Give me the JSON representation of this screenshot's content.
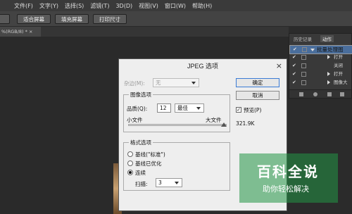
{
  "menubar": {
    "items": [
      "文件(F)",
      "文字(Y)",
      "选择(S)",
      "滤镜(T)",
      "3D(D)",
      "视图(V)",
      "窗口(W)",
      "帮助(H)"
    ]
  },
  "options_bar": {
    "buttons": [
      "适合屏幕",
      "填充屏幕",
      "打印尺寸"
    ]
  },
  "document_tab": {
    "label": "%(RGB/8) * ×"
  },
  "panel": {
    "tabs": [
      "历史记录",
      "动作"
    ],
    "rows": [
      "批量处理图",
      "打开",
      "关闭",
      "打开",
      "图像大"
    ]
  },
  "dialog": {
    "title": "JPEG 选项",
    "matte_label": "杂边(M):",
    "matte_value": "无",
    "image_options_title": "图像选项",
    "quality_label": "品质(Q):",
    "quality_value": "12",
    "quality_preset": "最佳",
    "small_file": "小文件",
    "large_file": "大文件",
    "quality_level": 1.0,
    "format_options_title": "格式选项",
    "format_baseline_standard": "基线(\"标准\")",
    "format_baseline_optimized": "基线已优化",
    "format_progressive": "连续",
    "scans_label": "扫描:",
    "scans_value": "3",
    "ok_button": "确定",
    "cancel_button": "取消",
    "preview_label": "预览(P)",
    "file_size": "321.9K"
  },
  "watermark": {
    "title": "百科全说",
    "subtitle": "助你轻松解决"
  },
  "colors": {
    "selection": "#4a6e9c",
    "dialog_bg": "#eeeeee",
    "watermark": "#229646"
  }
}
